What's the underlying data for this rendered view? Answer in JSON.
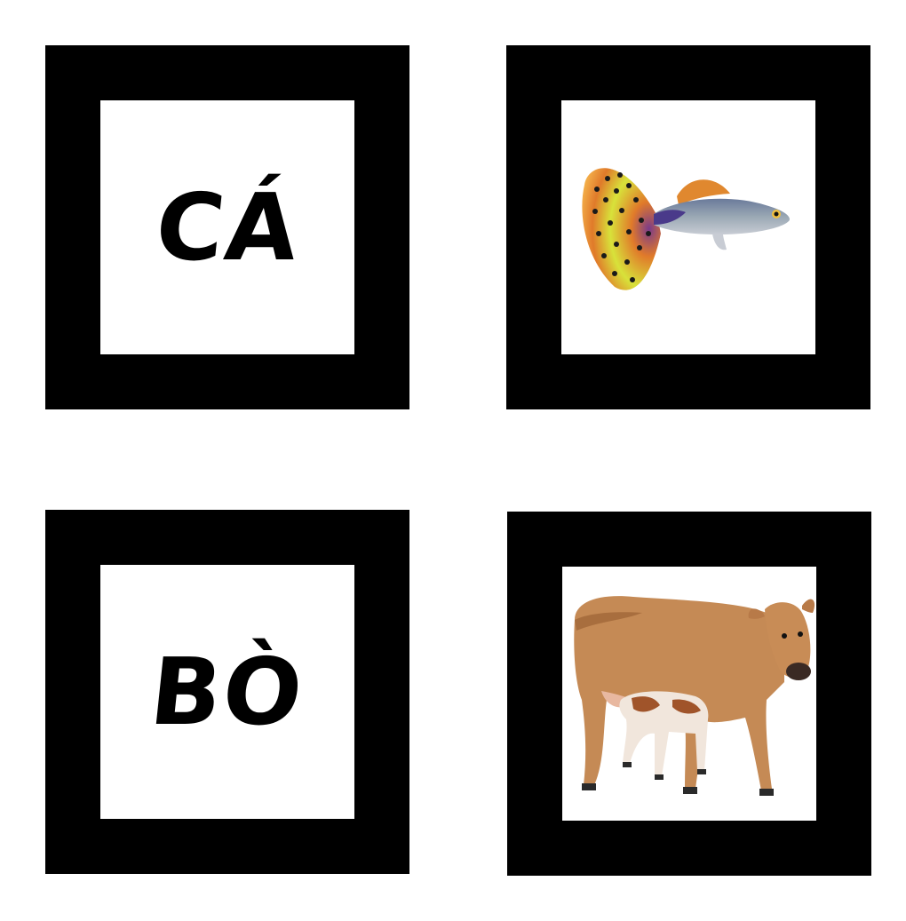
{
  "cards": [
    {
      "kind": "word",
      "text": "CÁ"
    },
    {
      "kind": "picture",
      "subject": "guppy-fish",
      "icon": "fish-icon"
    },
    {
      "kind": "word",
      "text": "BÒ"
    },
    {
      "kind": "picture",
      "subject": "cow-with-calf",
      "icon": "cow-icon"
    }
  ],
  "colors": {
    "frame": "#000000",
    "background": "#ffffff",
    "fish_tail_yellow": "#d8e23a",
    "fish_tail_orange": "#e07a2a",
    "fish_body": "#8a9aa8",
    "cow_body": "#c58a55",
    "calf_patch": "#a0542a"
  }
}
